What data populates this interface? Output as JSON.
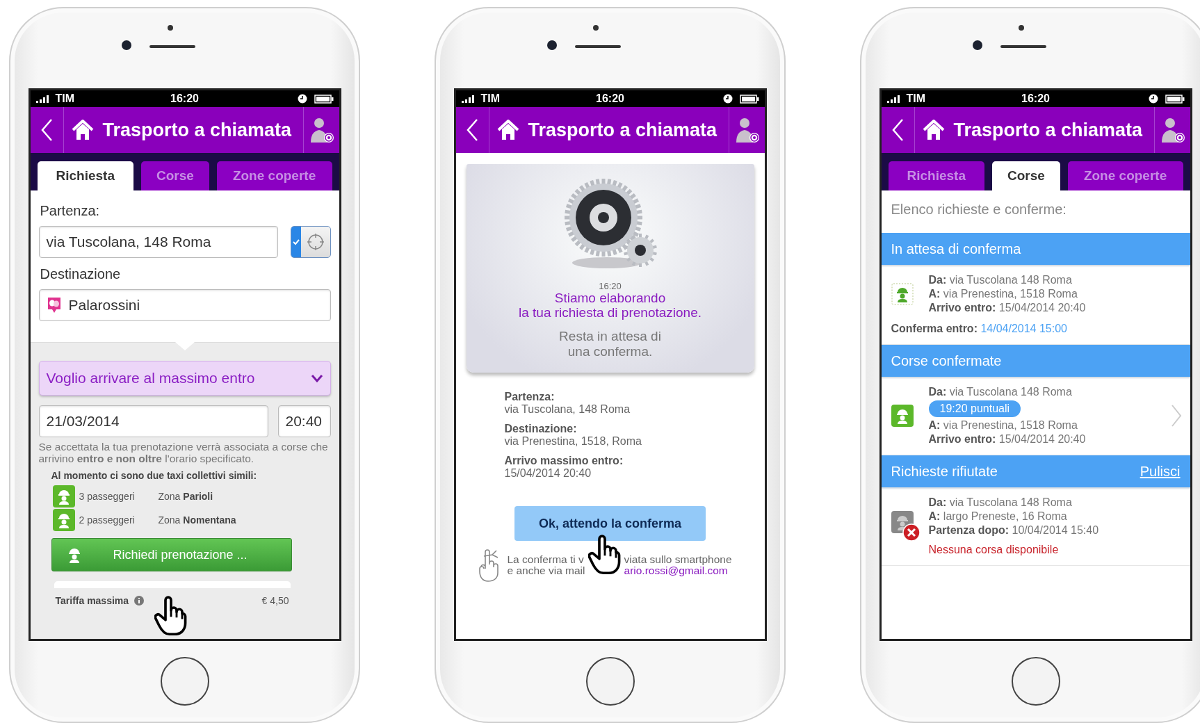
{
  "phones": [
    {
      "kind": "request",
      "status_bar": {
        "carrier": "TIM",
        "time": "16:20"
      },
      "title": "Trasporto a chiamata",
      "tabs": [
        {
          "label": "Richiesta",
          "selected": true
        },
        {
          "label": "Corse",
          "selected": false
        },
        {
          "label": "Zone coperte",
          "selected": false
        }
      ],
      "departure_label": "Partenza:",
      "departure_value": "via Tuscolana, 148 Roma",
      "locate_toggle": {
        "on": true
      },
      "destination_label": "Destinazione",
      "destination_value": "Palarossini",
      "arrival_dropdown": "Voglio arrivare al massimo entro",
      "date_value": "21/03/2014",
      "time_value": "20:40",
      "note": "Se accettata la tua prenotazione verrà associata a corse che arrivino **entro e non oltre** l'orario specificato.",
      "similar_title": "Al momento ci sono due taxi collettivi simili:",
      "similar": [
        {
          "passengers": "3 passeggeri",
          "zone": "Zona **Parioli**"
        },
        {
          "passengers": "2 passeggeri",
          "zone": "Zona **Nomentana**"
        }
      ],
      "book_button": "Richiedi prenotazione ...",
      "fare_label": "Tariffa massima",
      "fare_value": "€ 4,50"
    },
    {
      "kind": "processing",
      "status_bar": {
        "carrier": "TIM",
        "time": "16:20"
      },
      "title": "Trasporto a chiamata",
      "time": "16:20",
      "message": [
        "Stiamo elaborando",
        "la tua richiesta di prenotazione."
      ],
      "wait": [
        "Resta in attesa di",
        "una conferma."
      ],
      "details": [
        {
          "label": "Partenza:",
          "value": "via Tuscolana, 148 Roma"
        },
        {
          "label": "Destinazione:",
          "value": "via Prenestina, 1518, Roma"
        },
        {
          "label": "Arrivo massimo entro:",
          "value": "15/04/2014 20:40"
        }
      ],
      "ok_button": "Ok, attendo la conferma",
      "note_lines": [
        {
          "start": "La conferma ti v",
          "end": "viata sullo smartphone"
        },
        {
          "start": "e anche via mail",
          "email": "ario.rossi@gmail.com"
        }
      ]
    },
    {
      "kind": "rides",
      "status_bar": {
        "carrier": "TIM",
        "time": "16:20"
      },
      "title": "Trasporto a chiamata",
      "tabs": [
        {
          "label": "Richiesta",
          "selected": false
        },
        {
          "label": "Corse",
          "selected": true
        },
        {
          "label": "Zone coperte",
          "selected": false
        }
      ],
      "intro": "Elenco richieste e conferme:",
      "sections": [
        {
          "title": "In attesa di conferma",
          "items": [
            {
              "kind": "pending",
              "lines": [
                {
                  "kind": "text",
                  "text": "**Da:** via Tuscolana 148 Roma"
                },
                {
                  "kind": "text",
                  "text": "**A:** via Prenestina, 1518 Roma"
                },
                {
                  "kind": "text",
                  "text": "**Arrivo entro:** 15/04/2014 20:40"
                }
              ],
              "confirm_label": "Conferma entro:",
              "confirm_value": "14/04/2014 15:00"
            }
          ]
        },
        {
          "title": "Corse confermate",
          "items": [
            {
              "kind": "confirmed",
              "lines": [
                {
                  "kind": "text",
                  "text": "**Da:** via Tuscolana 148 Roma"
                },
                {
                  "kind": "badge",
                  "text": "19:20 puntuali"
                },
                {
                  "kind": "text",
                  "text": "**A:** via Prenestina, 1518 Roma"
                },
                {
                  "kind": "text",
                  "text": "**Arrivo entro:** 15/04/2014 20:40"
                }
              ]
            }
          ]
        },
        {
          "title": "Richieste rifiutate",
          "action": "Pulisci",
          "items": [
            {
              "kind": "rejected",
              "lines": [
                {
                  "kind": "text",
                  "text": "**Da:** via Tuscolana 148 Roma"
                },
                {
                  "kind": "text",
                  "text": "**A:** largo Preneste, 16 Roma"
                },
                {
                  "kind": "text",
                  "text": "**Partenza dopo:** 10/04/2014 15:40"
                }
              ],
              "error": "Nessuna corsa disponibile"
            }
          ]
        }
      ]
    }
  ]
}
